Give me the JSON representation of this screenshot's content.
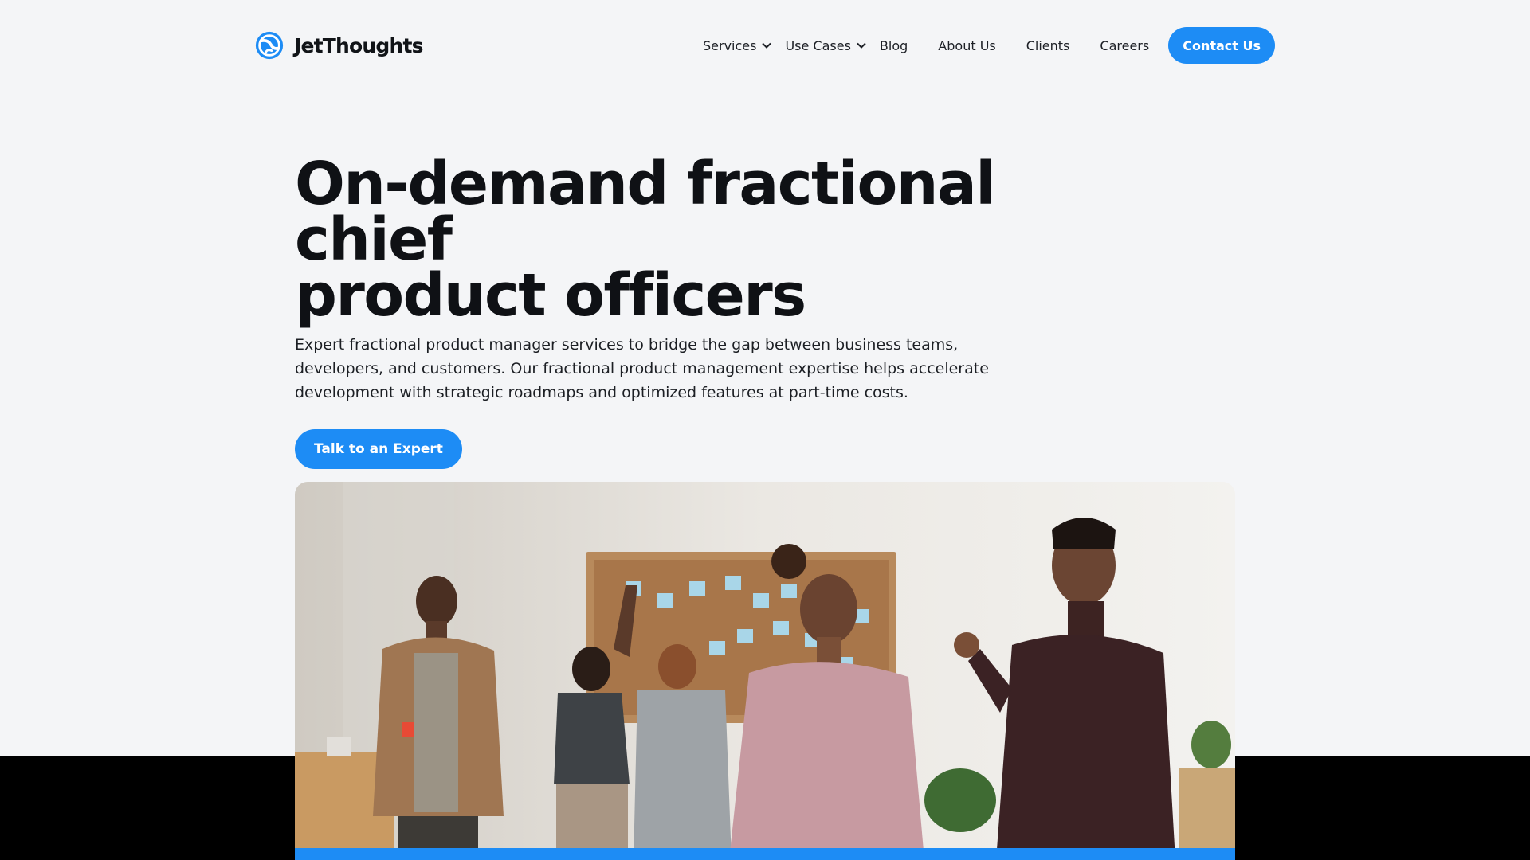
{
  "brand": {
    "name": "JetThoughts",
    "logo_icon": "globe-logo-icon",
    "accent_color": "#1d8cf5"
  },
  "nav": {
    "services": "Services",
    "use_cases": "Use Cases",
    "blog": "Blog",
    "about": "About Us",
    "clients": "Clients",
    "careers": "Careers",
    "contact": "Contact Us",
    "dropdown_icon": "chevron-down-icon"
  },
  "hero": {
    "title_line1": "On-demand fractional chief",
    "title_line2": "product officers",
    "description": "Expert fractional product manager services to bridge the gap between business teams, developers, and customers. Our fractional product management expertise helps accelerate development with strategic roadmaps and optimized features at part-time costs.",
    "cta": "Talk to an Expert"
  },
  "image": {
    "description_icon": "team-meeting-photo"
  }
}
